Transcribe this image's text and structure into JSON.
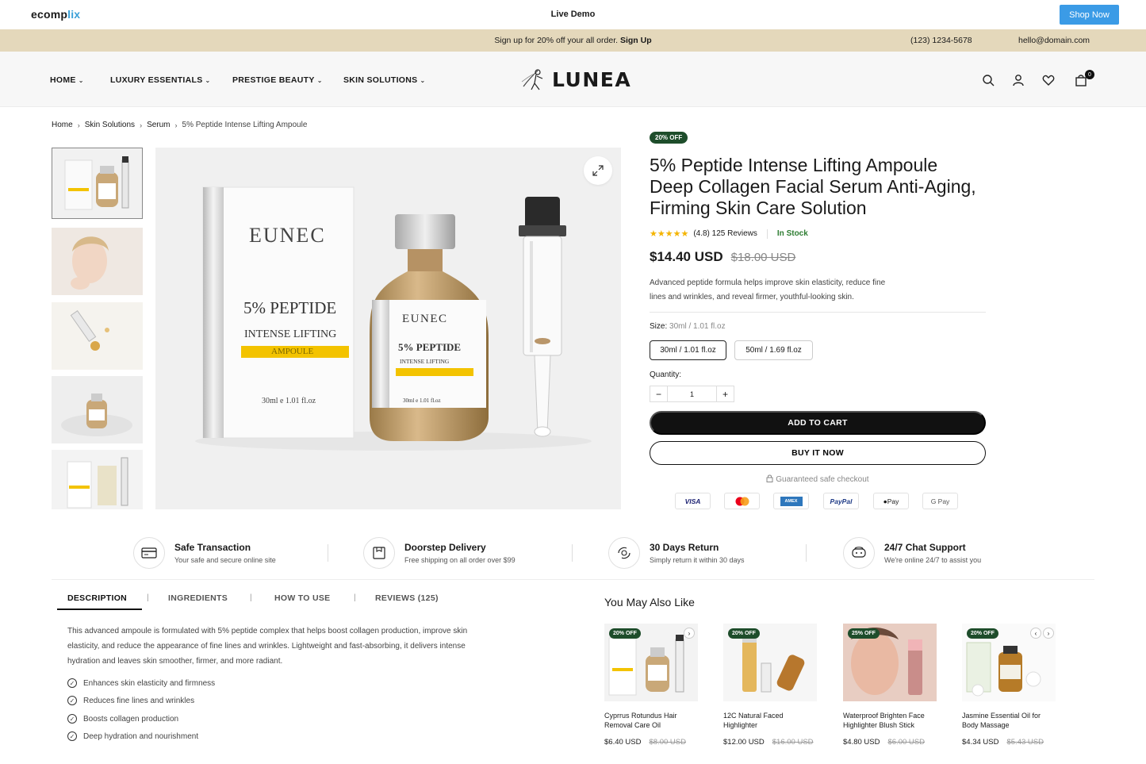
{
  "topbar": {
    "logo_part1": "ecomp",
    "logo_part2": "lix",
    "live_demo": "Live Demo",
    "shop_now": "Shop Now"
  },
  "announcement": {
    "message": "Sign up for 20% off your all order.",
    "signup_link": "Sign Up",
    "phone": "(123) 1234-5678",
    "email": "hello@domain.com"
  },
  "nav": {
    "items": [
      {
        "label": "HOME"
      },
      {
        "label": "LUXURY ESSENTIALS"
      },
      {
        "label": "PRESTIGE BEAUTY"
      },
      {
        "label": "SKIN SOLUTIONS"
      }
    ],
    "brand": "LUNEA",
    "cart_count": "0",
    "icons": [
      "search-icon",
      "account-icon",
      "heart-icon",
      "cart-icon"
    ]
  },
  "breadcrumb": {
    "items": [
      "Home",
      "Skin Solutions",
      "Serum"
    ],
    "current": "5% Peptide Intense Lifting Ampoule",
    "separator": "›"
  },
  "product_image": {
    "box_brand": "EUNEC",
    "box_line1": "5% PEPTIDE",
    "box_line2": "INTENSE LIFTING",
    "box_line3": "AMPOULE",
    "box_volume": "30ml e 1.01 fl.oz",
    "bottle_brand": "EUNEC",
    "bottle_line1": "5% PEPTIDE",
    "bottle_line2": "INTENSE LIFTING",
    "bottle_volume": "30ml e 1.01 fl.oz"
  },
  "product": {
    "badge": "20% OFF",
    "title": "5% Peptide Intense Lifting Ampoule Deep Collagen Facial Serum Anti-Aging, Firming Skin Care Solution",
    "stars": "★★★★★",
    "rating_text": "(4.8) 125 Reviews",
    "rating_value": 4.8,
    "stock": "In Stock",
    "price": "$14.40 USD",
    "compare_price": "$18.00 USD",
    "description": "Advanced peptide formula helps improve skin elasticity, reduce fine lines and wrinkles, and reveal firmer, youthful-looking skin.",
    "size_label": "Size:",
    "size_selected": "30ml / 1.01 fl.oz",
    "sizes": [
      "30ml / 1.01 fl.oz",
      "50ml / 1.69 fl.oz"
    ],
    "quantity_label": "Quantity:",
    "quantity": "1",
    "qty_minus": "−",
    "qty_plus": "+",
    "add_to_cart": "ADD TO CART",
    "buy_now": "BUY IT NOW",
    "guarantee": "Guaranteed safe checkout",
    "payments": [
      "VISA",
      "Mastercard",
      "AMEX",
      "PayPal",
      "Pay",
      "G Pay"
    ]
  },
  "features": [
    {
      "title": "Safe Transaction",
      "subtitle": "Your safe and secure online site",
      "icon": "card-icon"
    },
    {
      "title": "Doorstep Delivery",
      "subtitle": "Free shipping on all order over $99",
      "icon": "delivery-icon"
    },
    {
      "title": "30 Days Return",
      "subtitle": "Simply return it within 30 days",
      "icon": "return-icon"
    },
    {
      "title": "24/7 Chat Support",
      "subtitle": "We're online 24/7 to assist you",
      "icon": "chat-icon"
    }
  ],
  "tabs": {
    "items": [
      "DESCRIPTION",
      "INGREDIENTS",
      "HOW TO USE",
      "REVIEWS (125)"
    ],
    "separator": "|",
    "active": "DESCRIPTION",
    "description": "This advanced ampoule is formulated with 5% peptide complex that helps boost collagen production, improve skin elasticity, and reduce the appearance of fine lines and wrinkles. Lightweight and fast-absorbing, it delivers intense hydration and leaves skin smoother, firmer, and more radiant.",
    "benefits": [
      "Enhances skin elasticity and firmness",
      "Reduces fine lines and wrinkles",
      "Boosts collagen production",
      "Deep hydration and nourishment"
    ]
  },
  "also_like": {
    "title": "You May Also Like",
    "products": [
      {
        "badge": "20% OFF",
        "name": "Cyprrus Rotundus Hair Removal Care Oil",
        "price": "$6.40 USD",
        "compare": "$8.00 USD"
      },
      {
        "badge": "20% OFF",
        "name": "12C Natural Faced Highlighter",
        "price": "$12.00 USD",
        "compare": "$16.00 USD"
      },
      {
        "badge": "25% OFF",
        "name": "Waterproof Brighten Face Highlighter Blush Stick",
        "price": "$4.80 USD",
        "compare": "$6.00 USD"
      },
      {
        "badge": "20% OFF",
        "name": "Jasmine Essential Oil for Body Massage",
        "price": "$4.34 USD",
        "compare": "$5.43 USD"
      }
    ]
  },
  "colors": {
    "announcement_bg": "#e4d8bb",
    "shop_now_bg": "#3b9be6",
    "badge_bg": "#1e4d2b",
    "in_stock": "#2e7d32",
    "star": "#f4b400"
  }
}
